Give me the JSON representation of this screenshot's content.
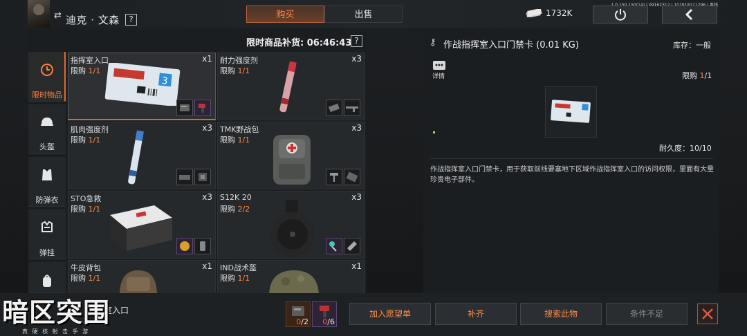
{
  "header": {
    "character_name": "迪克 · 文森",
    "help_mark": "?",
    "tabs": [
      {
        "label": "购买",
        "active": true
      },
      {
        "label": "出售",
        "active": false
      }
    ],
    "currency": "1732K",
    "version": "1.0.150.150(14) | 09162312 | 107918111296 | 离线"
  },
  "shop": {
    "restock_label": "限时商品补货: 06:46:43",
    "categories": [
      {
        "label": "限时物品",
        "icon": "clock-icon",
        "active": true
      },
      {
        "label": "头盔",
        "icon": "helmet-icon",
        "active": false
      },
      {
        "label": "防弹衣",
        "icon": "vest-icon",
        "active": false
      },
      {
        "label": "弹挂",
        "icon": "chest-rig-icon",
        "active": false
      },
      {
        "label": "",
        "icon": "backpack-icon",
        "active": false
      }
    ],
    "items": [
      {
        "name": "指挥室入口",
        "limit_prefix": "限购 ",
        "limit": "1/1",
        "qty": "x1",
        "art": "keycard"
      },
      {
        "name": "耐力强度剂",
        "limit_prefix": "限购 ",
        "limit": "1/1",
        "qty": "x3",
        "art": "syringe-red"
      },
      {
        "name": "肌肉强度剂",
        "limit_prefix": "限购 ",
        "limit": "1/1",
        "qty": "x3",
        "art": "syringe-blue"
      },
      {
        "name": "TMK野战包",
        "limit_prefix": "限购 ",
        "limit": "1/1",
        "qty": "x3",
        "art": "medkit-bag"
      },
      {
        "name": "STO急救",
        "limit_prefix": "限购 ",
        "limit": "1/1",
        "qty": "x3",
        "art": "first-aid-case"
      },
      {
        "name": "S12K 20",
        "limit_prefix": "限购 ",
        "limit": "2/2",
        "qty": "x3",
        "art": "drum-mag"
      },
      {
        "name": "牛皮背包",
        "limit_prefix": "限购 ",
        "limit": "1/1",
        "qty": "x1",
        "art": "backpack"
      },
      {
        "name": "IND战术盔",
        "limit_prefix": "限购 ",
        "limit": "1/1",
        "qty": "x1",
        "art": "helmet"
      }
    ]
  },
  "detail": {
    "title": "作战指挥室入口门禁卡 (0.01 KG)",
    "stock": "库存：一般",
    "details_label": "详情",
    "limit_prefix": "限购 ",
    "limit_num": "1",
    "limit_total": "/1",
    "durability": "耐久度：10/10",
    "card_number": "3",
    "description": "作战指挥室入口门禁卡，用于获取前线要塞地下区域作战指挥室入口的访问权限，里面有大量珍贵电子部件。"
  },
  "bottom": {
    "selected_name": "室入口",
    "logo": "暗区突围",
    "logo_sub": "真 硬 核 射 击 手 游",
    "materials": [
      {
        "have": "0",
        "need": "/2",
        "icon": "hard-drive-icon"
      },
      {
        "have": "0",
        "need": "/6",
        "icon": "drill-icon"
      }
    ],
    "actions": {
      "wishlist": "加入愿望单",
      "restock": "补齐",
      "search": "搜索此物",
      "insufficient": "条件不足"
    }
  },
  "colors": {
    "accent": "#ff8a45",
    "tab_active": "#b4623b",
    "close": "#e3583c"
  }
}
